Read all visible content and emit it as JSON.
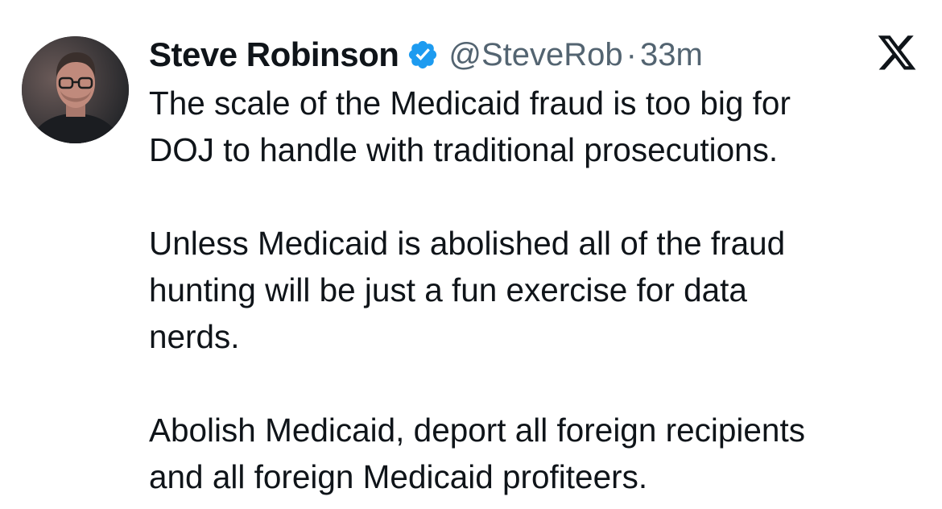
{
  "author": {
    "display_name": "Steve Robinson",
    "handle": "@SteveRob",
    "separator": "·",
    "time": "33m",
    "verified": true
  },
  "tweet": {
    "paragraphs": [
      "The scale of the Medicaid fraud is too big for\nDOJ to handle with traditional prosecutions.",
      "Unless Medicaid is abolished all of the fraud\nhunting will be just a fun exercise for data\nnerds.",
      "Abolish Medicaid, deport all foreign recipients\nand all foreign Medicaid profiteers."
    ]
  },
  "icons": {
    "verified": "verified-badge-icon",
    "brand": "x-logo-icon"
  },
  "colors": {
    "verified_blue": "#1d9bf0",
    "text_primary": "#0f1419",
    "text_secondary": "#536471"
  }
}
